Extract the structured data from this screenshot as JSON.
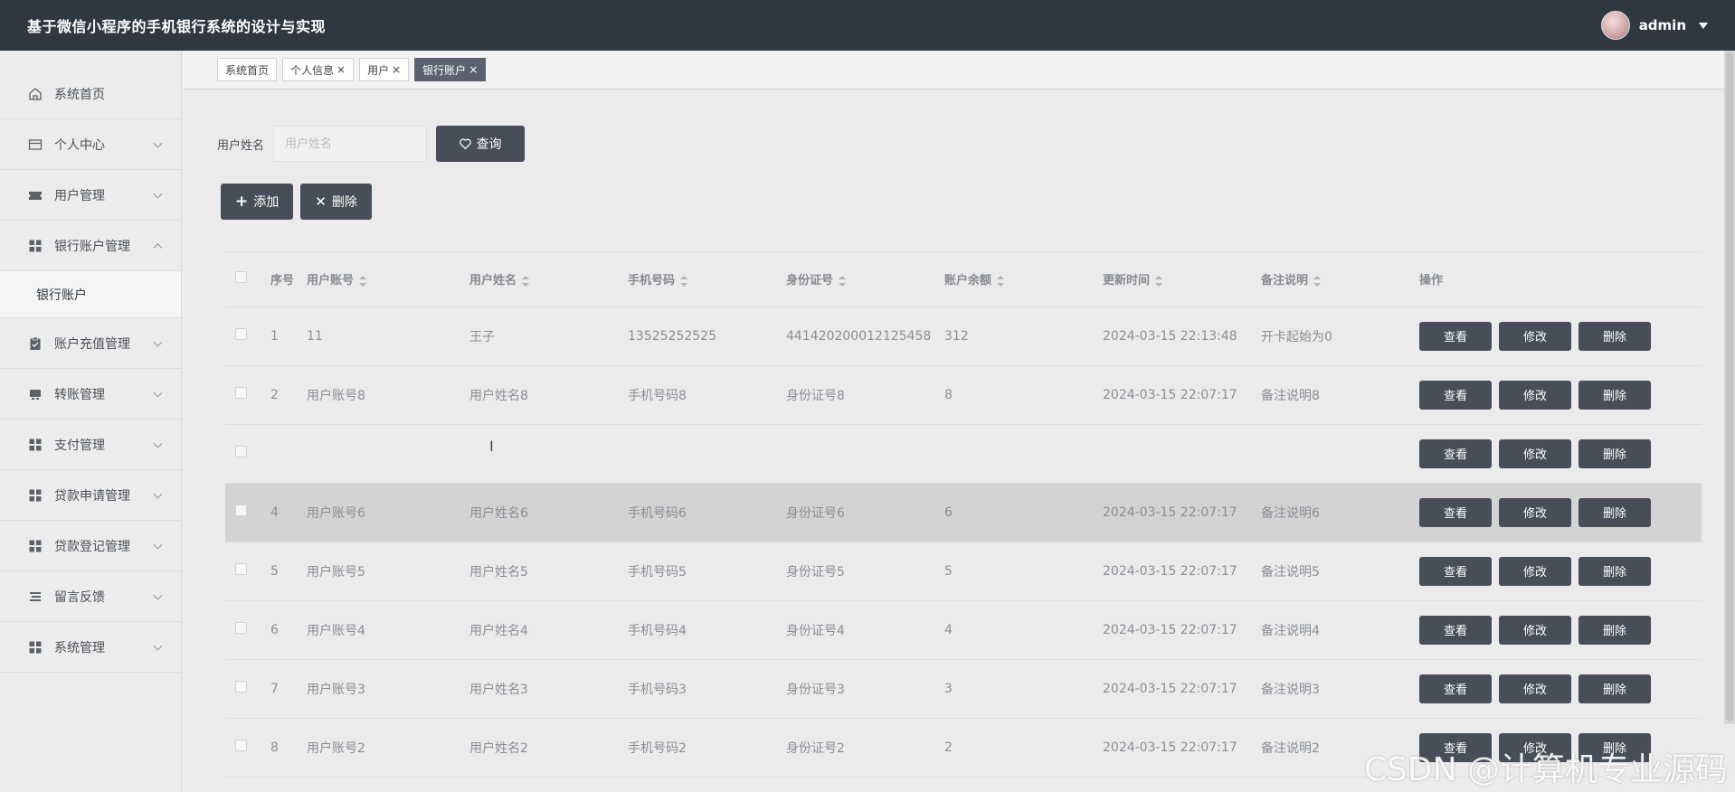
{
  "header": {
    "title": "基于微信小程序的手机银行系统的设计与实现",
    "username": "admin"
  },
  "sidebar": {
    "items": [
      {
        "label": "系统首页",
        "icon": "home-icon",
        "has_arrow": false
      },
      {
        "label": "个人中心",
        "icon": "card-icon",
        "has_arrow": true
      },
      {
        "label": "用户管理",
        "icon": "ticket-icon",
        "has_arrow": true
      },
      {
        "label": "银行账户管理",
        "icon": "grid-icon",
        "has_arrow": true,
        "open": true,
        "sub": [
          "银行账户"
        ]
      },
      {
        "label": "账户充值管理",
        "icon": "clipboard-icon",
        "has_arrow": true
      },
      {
        "label": "转账管理",
        "icon": "transfer-icon",
        "has_arrow": true
      },
      {
        "label": "支付管理",
        "icon": "grid-icon",
        "has_arrow": true
      },
      {
        "label": "贷款申请管理",
        "icon": "grid-icon",
        "has_arrow": true
      },
      {
        "label": "贷款登记管理",
        "icon": "grid-icon",
        "has_arrow": true
      },
      {
        "label": "留言反馈",
        "icon": "list-icon",
        "has_arrow": true
      },
      {
        "label": "系统管理",
        "icon": "grid-icon",
        "has_arrow": true
      }
    ]
  },
  "tabs": [
    {
      "label": "系统首页",
      "closable": false,
      "active": false
    },
    {
      "label": "个人信息",
      "closable": true,
      "active": false
    },
    {
      "label": "用户",
      "closable": true,
      "active": false
    },
    {
      "label": "银行账户",
      "closable": true,
      "active": true
    }
  ],
  "tab_close_glyph": "×",
  "search": {
    "label": "用户姓名",
    "placeholder": "用户姓名",
    "button": "查询"
  },
  "actions": {
    "add": "添加",
    "delete": "删除"
  },
  "table": {
    "columns": [
      "序号",
      "用户账号",
      "用户姓名",
      "手机号码",
      "身份证号",
      "账户余额",
      "更新时间",
      "备注说明",
      "操作"
    ],
    "sortable": [
      false,
      true,
      true,
      true,
      true,
      true,
      true,
      true,
      false
    ],
    "row_buttons": {
      "view": "查看",
      "edit": "修改",
      "delete": "删除"
    },
    "rows": [
      [
        "1",
        "11",
        "王子",
        "13525252525",
        "441420200012125458",
        "312",
        "2024-03-15 22:13:48",
        "开卡起始为0"
      ],
      [
        "2",
        "用户账号8",
        "用户姓名8",
        "手机号码8",
        "身份证号8",
        "8",
        "2024-03-15 22:07:17",
        "备注说明8"
      ],
      [
        "",
        "",
        "",
        "",
        "",
        "",
        "",
        ""
      ],
      [
        "4",
        "用户账号6",
        "用户姓名6",
        "手机号码6",
        "身份证号6",
        "6",
        "2024-03-15 22:07:17",
        "备注说明6"
      ],
      [
        "5",
        "用户账号5",
        "用户姓名5",
        "手机号码5",
        "身份证号5",
        "5",
        "2024-03-15 22:07:17",
        "备注说明5"
      ],
      [
        "6",
        "用户账号4",
        "用户姓名4",
        "手机号码4",
        "身份证号4",
        "4",
        "2024-03-15 22:07:17",
        "备注说明4"
      ],
      [
        "7",
        "用户账号3",
        "用户姓名3",
        "手机号码3",
        "身份证号3",
        "3",
        "2024-03-15 22:07:17",
        "备注说明3"
      ],
      [
        "8",
        "用户账号2",
        "用户姓名2",
        "手机号码2",
        "身份证号2",
        "2",
        "2024-03-15 22:07:17",
        "备注说明2"
      ]
    ],
    "highlighted_row": 3
  },
  "watermark": "CSDN @计算机专业源码"
}
